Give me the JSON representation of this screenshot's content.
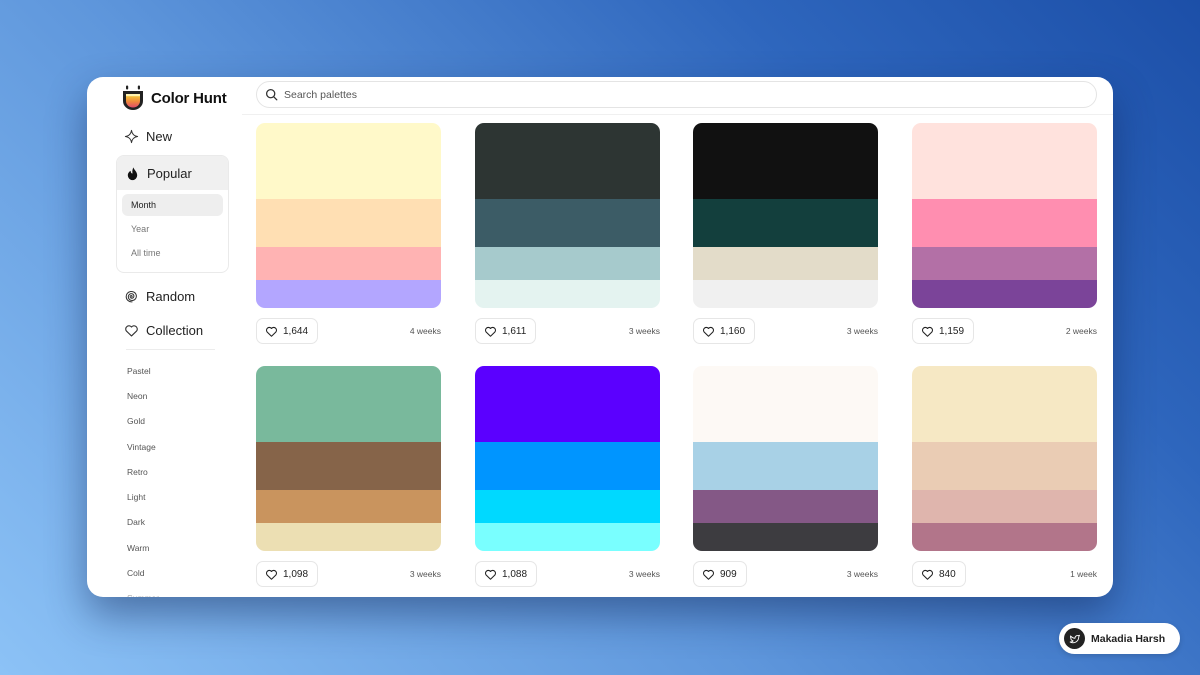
{
  "app": {
    "logo_text": "Color Hunt",
    "search_placeholder": "Search palettes"
  },
  "sidebar": {
    "new_label": "New",
    "popular_label": "Popular",
    "popular_sub": [
      "Month",
      "Year",
      "All time"
    ],
    "random_label": "Random",
    "collection_label": "Collection",
    "tags": [
      "Pastel",
      "Neon",
      "Gold",
      "Vintage",
      "Retro",
      "Light",
      "Dark",
      "Warm",
      "Cold",
      "Summer"
    ]
  },
  "palettes": [
    {
      "colors": [
        "#fff9c9",
        "#ffdfb3",
        "#ffb3b3",
        "#b3a6ff"
      ],
      "likes": "1,644",
      "age": "4 weeks"
    },
    {
      "colors": [
        "#2d3533",
        "#3c5c66",
        "#a6cacc",
        "#e4f3f0"
      ],
      "likes": "1,611",
      "age": "3 weeks"
    },
    {
      "colors": [
        "#111111",
        "#133f3d",
        "#e3dcc9",
        "#f0f0f0"
      ],
      "likes": "1,160",
      "age": "3 weeks"
    },
    {
      "colors": [
        "#ffe2dd",
        "#ff8eb0",
        "#b370a6",
        "#7b4499"
      ],
      "likes": "1,159",
      "age": "2 weeks"
    },
    {
      "colors": [
        "#79b99c",
        "#866449",
        "#c9945e",
        "#ecdfb3"
      ],
      "likes": "1,098",
      "age": "3 weeks"
    },
    {
      "colors": [
        "#5b00ff",
        "#0095ff",
        "#00d9ff",
        "#79ffff"
      ],
      "likes": "1,088",
      "age": "3 weeks"
    },
    {
      "colors": [
        "#fdf9f5",
        "#a8d1e6",
        "#845886",
        "#3d3c40"
      ],
      "likes": "909",
      "age": "3 weeks"
    },
    {
      "colors": [
        "#f6e8c4",
        "#eaccb4",
        "#dfb5ad",
        "#b2758a"
      ],
      "likes": "840",
      "age": "1 week"
    }
  ],
  "badge": {
    "name": "Makadia Harsh"
  }
}
